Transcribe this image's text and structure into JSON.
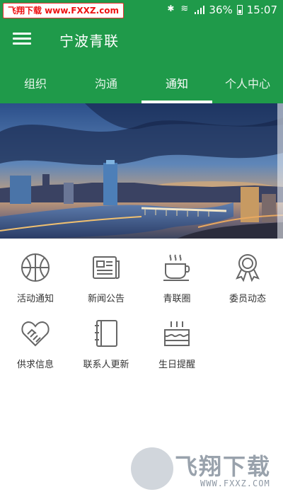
{
  "status_bar": {
    "watermark": "飞翔下载 www.FXXZ.com",
    "battery": "36%",
    "time": "15:07"
  },
  "app_bar": {
    "title": "宁波青联"
  },
  "tabs": [
    {
      "label": "组织",
      "active": false
    },
    {
      "label": "沟通",
      "active": false
    },
    {
      "label": "通知",
      "active": true
    },
    {
      "label": "个人中心",
      "active": false
    }
  ],
  "menu": [
    {
      "label": "活动通知",
      "icon": "basketball-icon"
    },
    {
      "label": "新闻公告",
      "icon": "newspaper-icon"
    },
    {
      "label": "青联圈",
      "icon": "coffee-cup-icon"
    },
    {
      "label": "委员动态",
      "icon": "award-ribbon-icon"
    },
    {
      "label": "供求信息",
      "icon": "heart-handshake-icon"
    },
    {
      "label": "联系人更新",
      "icon": "address-book-icon"
    },
    {
      "label": "生日提醒",
      "icon": "birthday-cake-icon"
    }
  ],
  "watermark_bottom": {
    "title": "飞翔下载",
    "url": "WWW.FXXZ.COM"
  },
  "colors": {
    "primary": "#1f9a4a",
    "icon_stroke": "#666666"
  }
}
